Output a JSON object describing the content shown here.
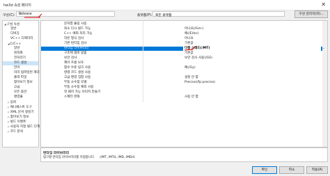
{
  "window": {
    "title": "hw3d 속성 페이지"
  },
  "toolbar": {
    "config_label": "구성(C):",
    "config_value": "Release",
    "platform_label": "플랫폼(P):",
    "platform_value": "모든 플랫폼",
    "config_manager": "구성 관리자(O)..."
  },
  "tree": [
    {
      "label": "구성 속성",
      "level": 0,
      "arrow": "◢"
    },
    {
      "label": "일반",
      "level": 1
    },
    {
      "label": "디버깅",
      "level": 1
    },
    {
      "label": "VC++ 디렉터리",
      "level": 1
    },
    {
      "label": "C/C++",
      "level": 1,
      "arrow": "◢"
    },
    {
      "label": "일반",
      "level": 2
    },
    {
      "label": "최적화",
      "level": 2
    },
    {
      "label": "전처리기",
      "level": 2
    },
    {
      "label": "코드 생성",
      "level": 2,
      "selected": true
    },
    {
      "label": "언어",
      "level": 2
    },
    {
      "label": "미리 컴파일된 헤더",
      "level": 2
    },
    {
      "label": "출력 파일",
      "level": 2
    },
    {
      "label": "찾아보기 정보",
      "level": 2
    },
    {
      "label": "고급",
      "level": 2
    },
    {
      "label": "모든 옵션",
      "level": 2
    },
    {
      "label": "명령줄",
      "level": 2
    },
    {
      "label": "링커",
      "level": 1,
      "arrow": "▷"
    },
    {
      "label": "매니페스트 도구",
      "level": 1,
      "arrow": "▷"
    },
    {
      "label": "XML 문서 생성기",
      "level": 1,
      "arrow": "▷"
    },
    {
      "label": "찾아보기 정보",
      "level": 1,
      "arrow": "▷"
    },
    {
      "label": "빌드 이벤트",
      "level": 1,
      "arrow": "▷"
    },
    {
      "label": "사용자 지정 빌드 단계",
      "level": 1,
      "arrow": "▷"
    },
    {
      "label": "코드 분석",
      "level": 1,
      "arrow": "▷"
    }
  ],
  "properties": [
    {
      "name": "문자열 풀링 사용",
      "value": ""
    },
    {
      "name": "최소 다시 빌드 가능",
      "value": "아니요(/Gm-)"
    },
    {
      "name": "C++ 예외 처리 가능",
      "value": "예(/EHsc)"
    },
    {
      "name": "작은 형식 검사",
      "value": "아니요"
    },
    {
      "name": "기본 런타임 검사",
      "value": "기본값"
    },
    {
      "name": "런타임 라이브러리",
      "value": "다중 스레드(/MT)",
      "selected": true
    },
    {
      "name": "구조체 멤버 맞춤",
      "value": "기본값"
    },
    {
      "name": "보안 검사",
      "value": "보안 검사 사용(/GS)"
    },
    {
      "name": "제어 흐름 보호",
      "value": ""
    },
    {
      "name": "함수 수준 링크 사용",
      "value": "예(/Gy)"
    },
    {
      "name": "병렬 코드 생성 사용",
      "value": ""
    },
    {
      "name": "고급 명령 집합 사용",
      "value": "설정 안 함"
    },
    {
      "name": "부동 소수점 모델",
      "value": "Precise(/fp:precise)"
    },
    {
      "name": "부동 소수점 예외 사용",
      "value": ""
    },
    {
      "name": "핫 패치 가능 이미지 만들기",
      "value": ""
    },
    {
      "name": "스펙터 완화",
      "value": "사용 안 함"
    }
  ],
  "description": {
    "title": "런타임 라이브러리",
    "text": "링크할 런타임 라이브러리를 지정합니다.     (/MT, /MTd, /MD, /MDd)"
  },
  "buttons": {
    "ok": "확인",
    "cancel": "취소",
    "apply": "적용(A)"
  }
}
